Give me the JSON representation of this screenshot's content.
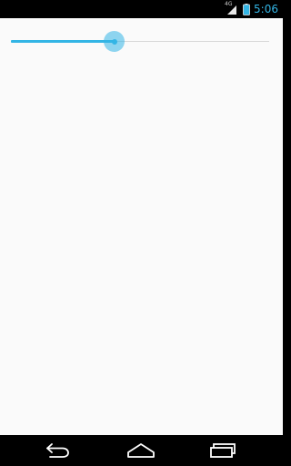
{
  "status_bar": {
    "network_label": "4G",
    "time": "5:06",
    "accent": "#33b5e5",
    "icons": [
      "signal-icon",
      "battery-icon"
    ]
  },
  "slider": {
    "value_fraction": 0.4
  },
  "navigation": {
    "buttons": [
      "back-icon",
      "home-icon",
      "recents-icon"
    ]
  }
}
